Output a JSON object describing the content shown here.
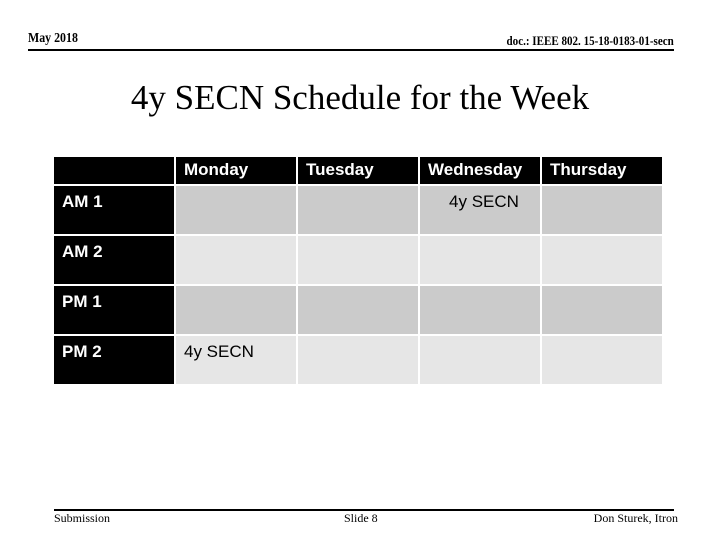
{
  "header": {
    "date": "May 2018",
    "doc_id": "doc.: IEEE 802. 15-18-0183-01-secn"
  },
  "title": "4y SECN Schedule for the Week",
  "schedule": {
    "columns": [
      "",
      "Monday",
      "Tuesday",
      "Wednesday",
      "Thursday"
    ],
    "rows": [
      {
        "label": "AM 1",
        "cells": [
          "",
          "",
          "4y SECN",
          ""
        ]
      },
      {
        "label": "AM 2",
        "cells": [
          "",
          "",
          "",
          ""
        ]
      },
      {
        "label": "PM 1",
        "cells": [
          "",
          "",
          "",
          ""
        ]
      },
      {
        "label": "PM 2",
        "cells": [
          "4y SECN",
          "",
          "",
          ""
        ]
      }
    ]
  },
  "footer": {
    "left": "Submission",
    "center": "Slide 8",
    "right": "Don Sturek, Itron"
  }
}
